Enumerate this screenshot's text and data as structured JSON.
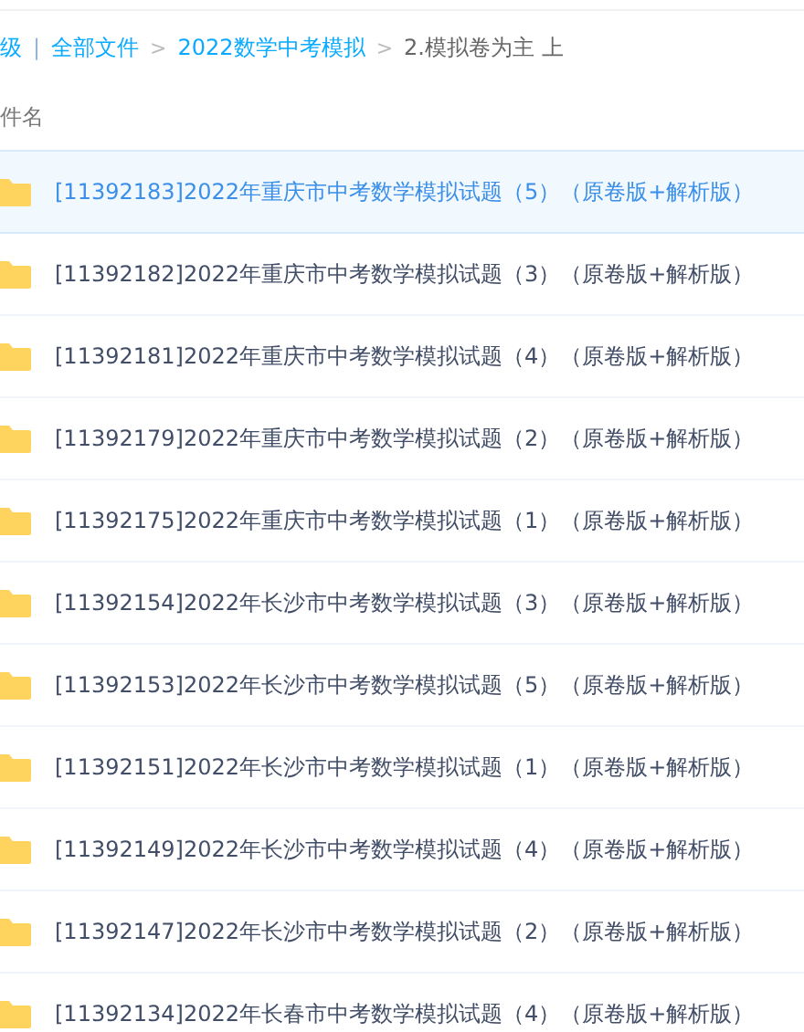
{
  "breadcrumb": {
    "items": [
      {
        "label": "级",
        "kind": "link"
      },
      {
        "label": "|",
        "kind": "separator"
      },
      {
        "label": "全部文件",
        "kind": "link"
      },
      {
        "label": ">",
        "kind": "arrow"
      },
      {
        "label": "2022数学中考模拟",
        "kind": "link"
      },
      {
        "label": ">",
        "kind": "arrow"
      },
      {
        "label": "2.模拟卷为主 上",
        "kind": "current"
      }
    ]
  },
  "table": {
    "columns": [
      "件名"
    ],
    "rows": [
      {
        "name": "[11392183]2022年重庆市中考数学模拟试题（5）（原卷版+解析版）",
        "selected": true
      },
      {
        "name": "[11392182]2022年重庆市中考数学模拟试题（3）（原卷版+解析版）",
        "selected": false
      },
      {
        "name": "[11392181]2022年重庆市中考数学模拟试题（4）（原卷版+解析版）",
        "selected": false
      },
      {
        "name": "[11392179]2022年重庆市中考数学模拟试题（2）（原卷版+解析版）",
        "selected": false
      },
      {
        "name": "[11392175]2022年重庆市中考数学模拟试题（1）（原卷版+解析版）",
        "selected": false
      },
      {
        "name": "[11392154]2022年长沙市中考数学模拟试题（3）（原卷版+解析版）",
        "selected": false
      },
      {
        "name": "[11392153]2022年长沙市中考数学模拟试题（5）（原卷版+解析版）",
        "selected": false
      },
      {
        "name": "[11392151]2022年长沙市中考数学模拟试题（1）（原卷版+解析版）",
        "selected": false
      },
      {
        "name": "[11392149]2022年长沙市中考数学模拟试题（4）（原卷版+解析版）",
        "selected": false
      },
      {
        "name": "[11392147]2022年长沙市中考数学模拟试题（2）（原卷版+解析版）",
        "selected": false
      },
      {
        "name": "[11392134]2022年长春市中考数学模拟试题（4）（原卷版+解析版）",
        "selected": false
      }
    ]
  }
}
